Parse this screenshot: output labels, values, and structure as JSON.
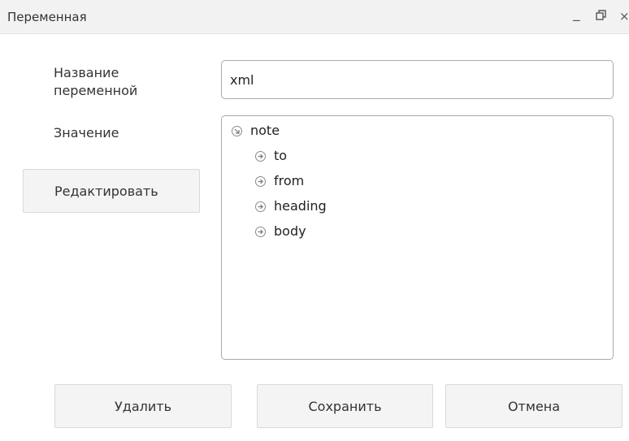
{
  "window": {
    "title": "Переменная",
    "minimize_glyph": "_",
    "maximize_icon": "restore-icon",
    "close_glyph": "×"
  },
  "form": {
    "name_label": "Название переменной",
    "name_value": "xml",
    "value_label": "Значение"
  },
  "tree": {
    "root": {
      "label": "note",
      "icon": "expanded-arrow-icon"
    },
    "children": [
      {
        "label": "to",
        "icon": "collapsed-arrow-icon"
      },
      {
        "label": "from",
        "icon": "collapsed-arrow-icon"
      },
      {
        "label": "heading",
        "icon": "collapsed-arrow-icon"
      },
      {
        "label": "body",
        "icon": "collapsed-arrow-icon"
      }
    ]
  },
  "buttons": {
    "edit": "Редактировать",
    "delete": "Удалить",
    "save": "Сохранить",
    "cancel": "Отмена"
  },
  "colors": {
    "titlebar_bg": "#f2f2f2",
    "button_bg": "#f4f4f4",
    "border": "#a9a9a9"
  }
}
